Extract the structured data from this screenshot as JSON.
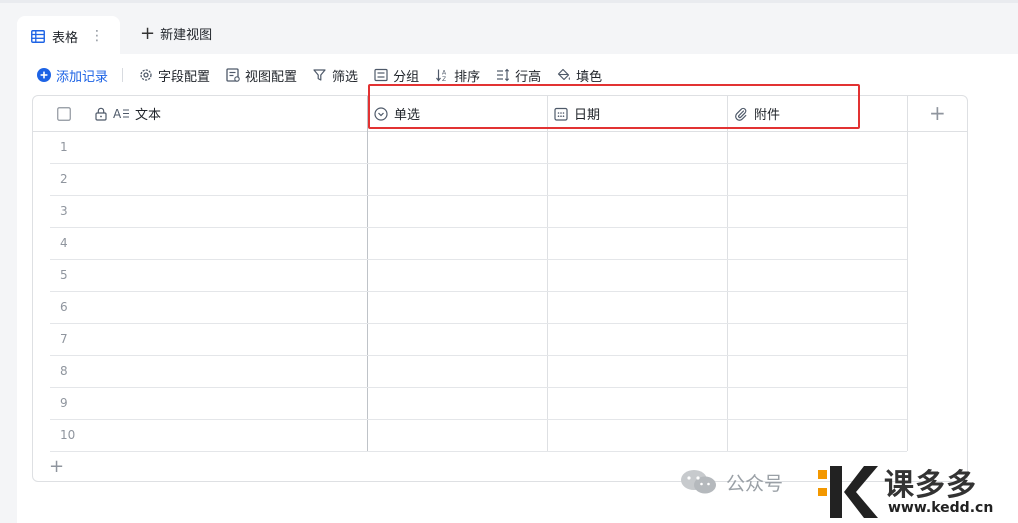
{
  "view_tabs": {
    "active_tab_label": "表格",
    "new_view_label": "新建视图"
  },
  "toolbar": {
    "add_record": "添加记录",
    "field_config": "字段配置",
    "view_config": "视图配置",
    "filter": "筛选",
    "group": "分组",
    "sort": "排序",
    "row_height": "行高",
    "fill_color": "填色"
  },
  "table": {
    "columns": [
      {
        "label": "文本",
        "type_icon": "text-field-icon"
      },
      {
        "label": "单选",
        "type_icon": "single-select-icon"
      },
      {
        "label": "日期",
        "type_icon": "calendar-icon"
      },
      {
        "label": "附件",
        "type_icon": "paperclip-icon"
      }
    ],
    "row_numbers": [
      "1",
      "2",
      "3",
      "4",
      "5",
      "6",
      "7",
      "8",
      "9",
      "10"
    ]
  },
  "watermark": {
    "account": "公众号",
    "brand_name": "课多多",
    "brand_url": "www.kedd.cn"
  },
  "colors": {
    "accent": "#1d63e5",
    "highlight_box": "#e23232",
    "brand_orange": "#f39800"
  }
}
